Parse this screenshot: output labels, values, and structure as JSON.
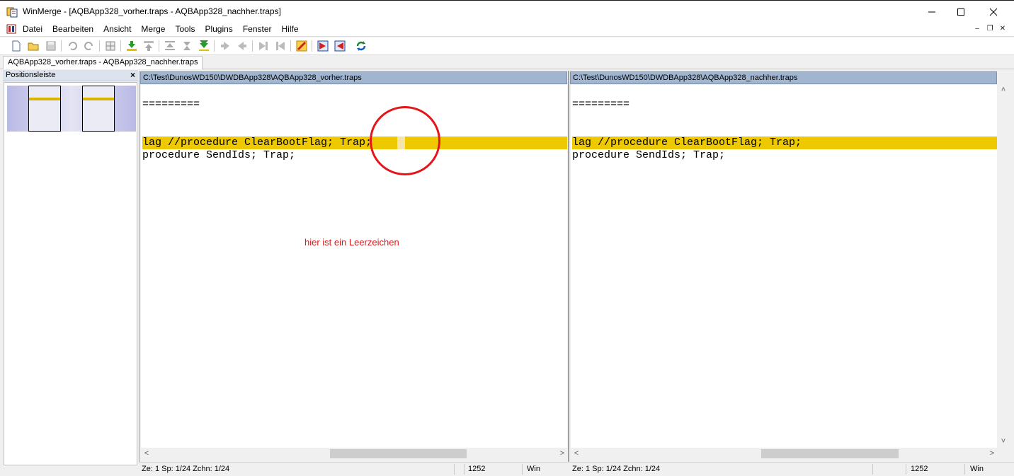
{
  "window": {
    "title": "WinMerge - [AQBApp328_vorher.traps - AQBApp328_nachher.traps]"
  },
  "menu": {
    "items": [
      "Datei",
      "Bearbeiten",
      "Ansicht",
      "Merge",
      "Tools",
      "Plugins",
      "Fenster",
      "Hilfe"
    ]
  },
  "toolbar": {
    "buttons": [
      "new-icon",
      "open-icon",
      "save-icon",
      "undo-icon",
      "redo-icon",
      "options-icon",
      "next-diff-icon",
      "prev-diff-icon",
      "first-diff-icon",
      "current-diff-icon",
      "last-diff-icon",
      "copy-right-icon",
      "copy-left-icon",
      "copy-right-advance-icon",
      "copy-left-advance-icon",
      "all-right-icon",
      "all-left-icon",
      "refresh-icon"
    ]
  },
  "tab": {
    "label": "AQBApp328_vorher.traps - AQBApp328_nachher.traps"
  },
  "location_pane": {
    "title": "Positionsleiste",
    "close": "×"
  },
  "left_pane": {
    "path": "C:\\Test\\DunosWD150\\DWDBApp328\\AQBApp328_vorher.traps",
    "lines": [
      "",
      "=========",
      "",
      "",
      "lag //procedure ClearBootFlag; Trap;",
      "procedure SendIds; Trap;"
    ]
  },
  "right_pane": {
    "path": "C:\\Test\\DunosWD150\\DWDBApp328\\AQBApp328_nachher.traps",
    "lines": [
      "",
      "=========",
      "",
      "",
      "lag //procedure ClearBootFlag; Trap;",
      "procedure SendIds; Trap;"
    ]
  },
  "annotation": {
    "text": "hier ist ein Leerzeichen",
    "color": "#e5151b"
  },
  "status_left": {
    "position": "Ze: 1  Sp: 1/24  Zchn: 1/24",
    "codepage": "1252",
    "eol": "Win"
  },
  "status_right": {
    "position": "Ze: 1  Sp: 1/24  Zchn: 1/24",
    "codepage": "1252",
    "eol": "Win"
  },
  "colors": {
    "diff_highlight": "#efc900",
    "pane_header": "#9fb5d0"
  }
}
